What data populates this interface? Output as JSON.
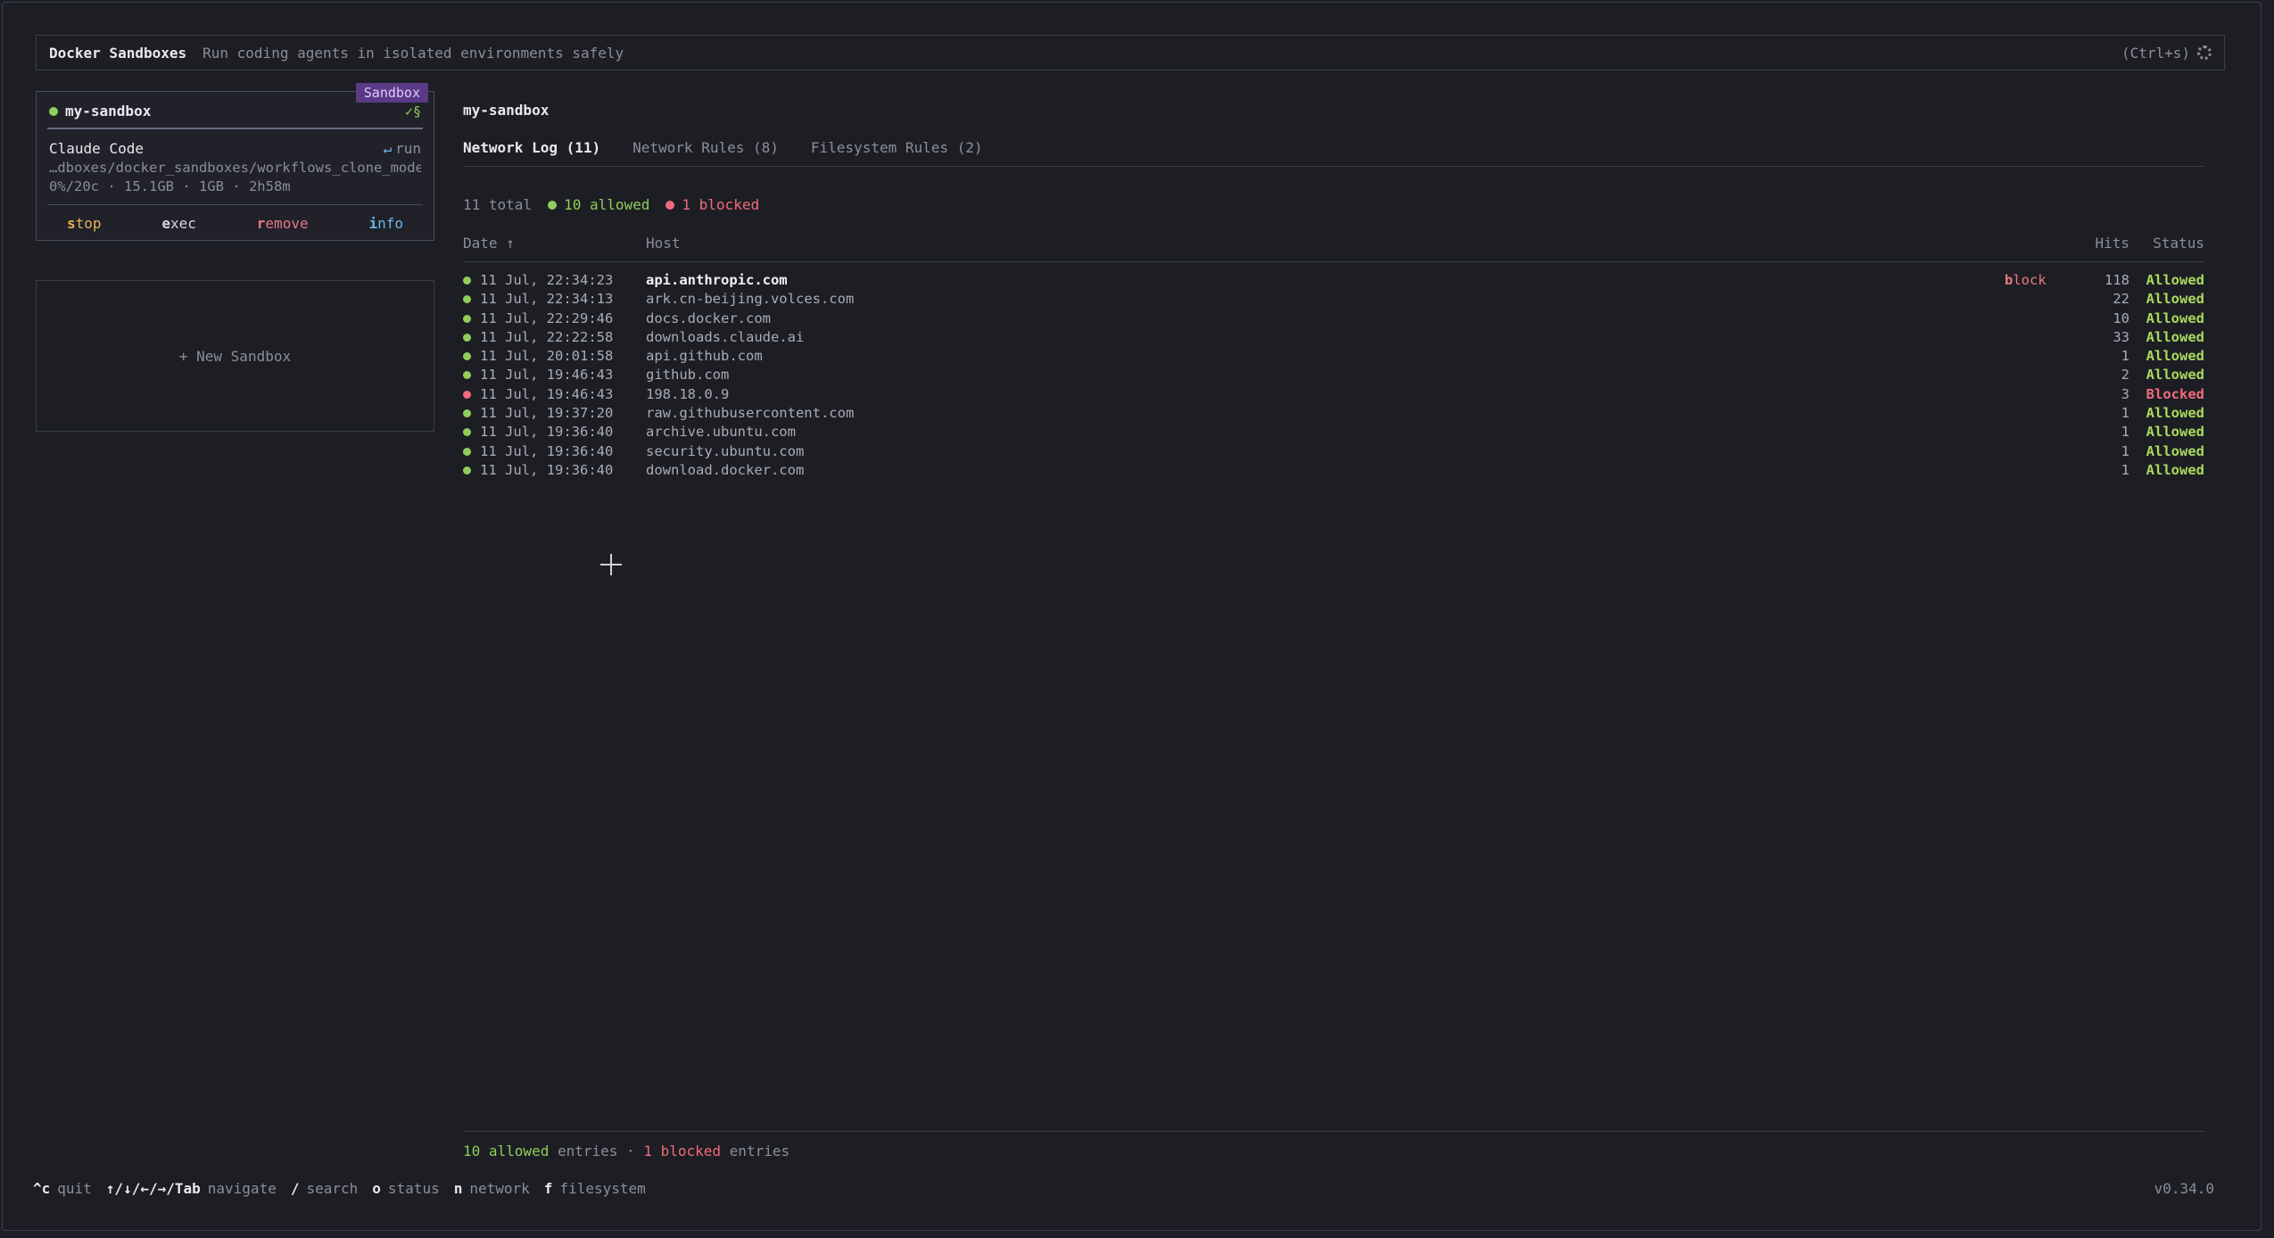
{
  "header": {
    "title": "Docker Sandboxes",
    "subtitle": "Run coding agents in isolated environments safely",
    "shortcut": "(Ctrl+s)",
    "settings_icon": "gear-icon"
  },
  "sandbox_card": {
    "badge": "Sandbox",
    "name": "my-sandbox",
    "check": "✓§",
    "agent": "Claude Code",
    "run_arrow": "↵",
    "run_label": "run",
    "path": "…dboxes/docker_sandboxes/workflows_clone_mode",
    "stats": "0%/20c · 15.1GB · 1GB · 2h58m",
    "actions": [
      {
        "key": "s",
        "rest": "top",
        "cls": "act-stop"
      },
      {
        "key": "e",
        "rest": "xec",
        "cls": "act-exec"
      },
      {
        "key": "r",
        "rest": "emove",
        "cls": "act-remove"
      },
      {
        "key": "i",
        "rest": "nfo",
        "cls": "act-info"
      }
    ]
  },
  "new_sandbox": "+ New Sandbox",
  "main": {
    "title": "my-sandbox",
    "tabs": [
      {
        "label": "Network Log (11)",
        "active": true
      },
      {
        "label": "Network Rules (8)",
        "active": false
      },
      {
        "label": "Filesystem Rules (2)",
        "active": false
      }
    ],
    "summary": {
      "total": "11 total",
      "allowed": "10 allowed",
      "blocked": "1 blocked"
    },
    "columns": {
      "date": "Date ↑",
      "host": "Host",
      "hits": "Hits",
      "status": "Status"
    },
    "rows": [
      {
        "date": "11 Jul, 22:34:23",
        "host": "api.anthropic.com",
        "hits": "118",
        "status": "Allowed",
        "state": "allowed",
        "selected": true,
        "action_key": "b",
        "action_rest": "lock"
      },
      {
        "date": "11 Jul, 22:34:13",
        "host": "ark.cn-beijing.volces.com",
        "hits": "22",
        "status": "Allowed",
        "state": "allowed"
      },
      {
        "date": "11 Jul, 22:29:46",
        "host": "docs.docker.com",
        "hits": "10",
        "status": "Allowed",
        "state": "allowed"
      },
      {
        "date": "11 Jul, 22:22:58",
        "host": "downloads.claude.ai",
        "hits": "33",
        "status": "Allowed",
        "state": "allowed"
      },
      {
        "date": "11 Jul, 20:01:58",
        "host": "api.github.com",
        "hits": "1",
        "status": "Allowed",
        "state": "allowed"
      },
      {
        "date": "11 Jul, 19:46:43",
        "host": "github.com",
        "hits": "2",
        "status": "Allowed",
        "state": "allowed"
      },
      {
        "date": "11 Jul, 19:46:43",
        "host": "198.18.0.9",
        "hits": "3",
        "status": "Blocked",
        "state": "blocked"
      },
      {
        "date": "11 Jul, 19:37:20",
        "host": "raw.githubusercontent.com",
        "hits": "1",
        "status": "Allowed",
        "state": "allowed"
      },
      {
        "date": "11 Jul, 19:36:40",
        "host": "archive.ubuntu.com",
        "hits": "1",
        "status": "Allowed",
        "state": "allowed"
      },
      {
        "date": "11 Jul, 19:36:40",
        "host": "security.ubuntu.com",
        "hits": "1",
        "status": "Allowed",
        "state": "allowed"
      },
      {
        "date": "11 Jul, 19:36:40",
        "host": "download.docker.com",
        "hits": "1",
        "status": "Allowed",
        "state": "allowed"
      }
    ],
    "footer": {
      "allowed_count": "10 allowed",
      "allowed_word": "entries",
      "separator": "·",
      "blocked_count": "1 blocked",
      "blocked_word": "entries"
    }
  },
  "keybar": [
    {
      "key": "^c",
      "label": "quit"
    },
    {
      "key": "↑/↓/←/→/Tab",
      "label": "navigate"
    },
    {
      "key": "/",
      "label": "search"
    },
    {
      "key": "o",
      "label": "status"
    },
    {
      "key": "n",
      "label": "network"
    },
    {
      "key": "f",
      "label": "filesystem"
    }
  ],
  "version": "v0.34.0",
  "colors": {
    "allowed": "#8fce5a",
    "blocked": "#f26b7a",
    "badge": "#5a3a84"
  }
}
